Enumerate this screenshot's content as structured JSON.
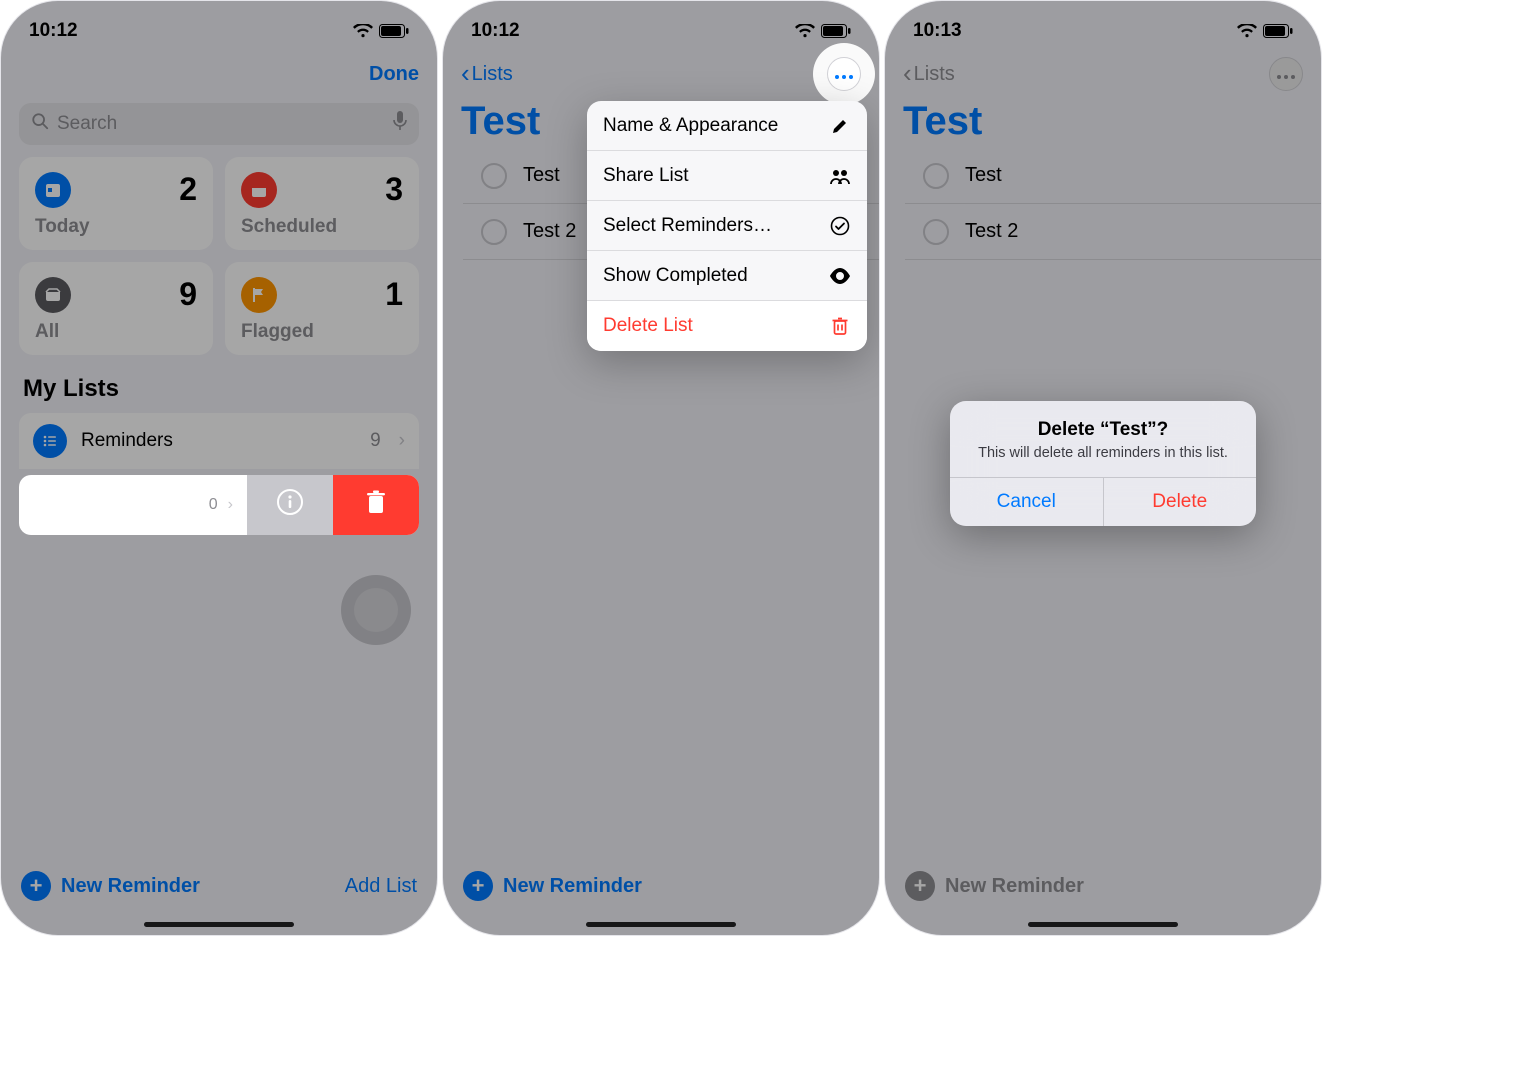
{
  "screen1": {
    "time": "10:12",
    "done": "Done",
    "search_placeholder": "Search",
    "tiles": {
      "today": {
        "label": "Today",
        "count": "2"
      },
      "scheduled": {
        "label": "Scheduled",
        "count": "3"
      },
      "all": {
        "label": "All",
        "count": "9"
      },
      "flagged": {
        "label": "Flagged",
        "count": "1"
      }
    },
    "my_lists_title": "My Lists",
    "reminders_list": {
      "name": "Reminders",
      "count": "9"
    },
    "swiped_list": {
      "count": "0"
    },
    "new_reminder": "New Reminder",
    "add_list": "Add List"
  },
  "screen2": {
    "time": "10:12",
    "back": "Lists",
    "title": "Test",
    "items": [
      "Test",
      "Test 2"
    ],
    "menu": {
      "name_appearance": "Name & Appearance",
      "share": "Share List",
      "select": "Select Reminders…",
      "show_completed": "Show Completed",
      "delete": "Delete List"
    },
    "new_reminder": "New Reminder"
  },
  "screen3": {
    "time": "10:13",
    "back": "Lists",
    "title": "Test",
    "items": [
      "Test",
      "Test 2"
    ],
    "alert": {
      "title": "Delete “Test”?",
      "message": "This will delete all reminders in this list.",
      "cancel": "Cancel",
      "delete": "Delete"
    },
    "new_reminder": "New Reminder"
  }
}
